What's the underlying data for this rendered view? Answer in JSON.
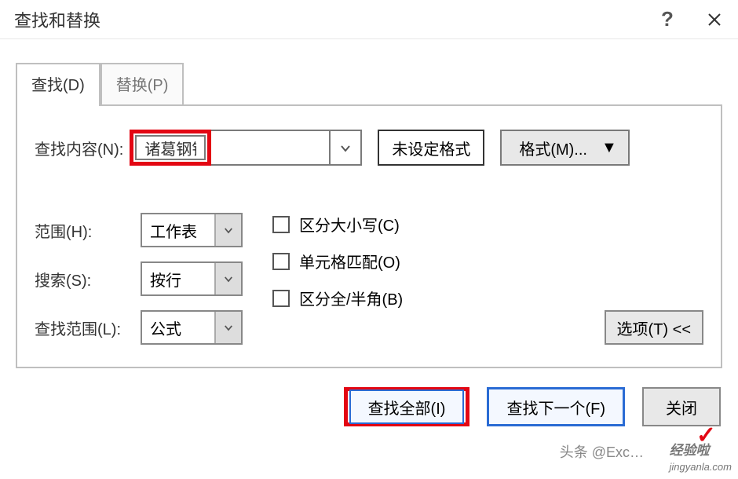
{
  "title": "查找和替换",
  "tabs": {
    "find": "查找(D)",
    "replace": "替换(P)"
  },
  "find": {
    "label": "查找内容(N):",
    "value": "诸葛钢铁",
    "format_status": "未设定格式",
    "format_button": "格式(M)..."
  },
  "options": {
    "scope_label": "范围(H):",
    "scope_value": "工作表",
    "search_label": "搜索(S):",
    "search_value": "按行",
    "lookin_label": "查找范围(L):",
    "lookin_value": "公式",
    "match_case": "区分大小写(C)",
    "match_cell": "单元格匹配(O)",
    "match_width": "区分全/半角(B)",
    "options_button": "选项(T) <<"
  },
  "actions": {
    "find_all": "查找全部(I)",
    "find_next": "查找下一个(F)",
    "close": "关闭"
  },
  "watermark": {
    "source": "头条 @Exc…",
    "site": "经验啦",
    "domain": "jingyanla.com"
  }
}
